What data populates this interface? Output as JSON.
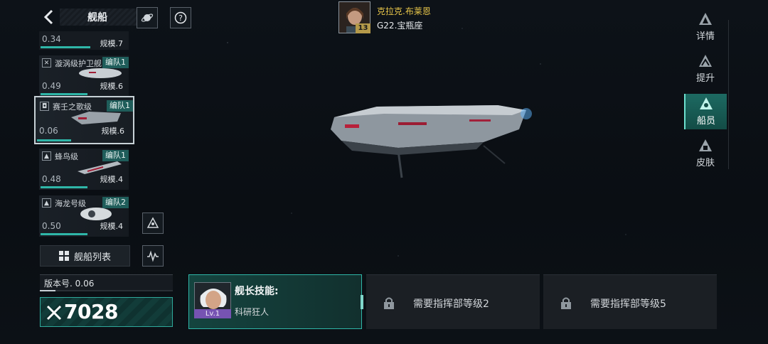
{
  "header": {
    "title": "舰船"
  },
  "commander": {
    "name": "克拉克.布莱恩",
    "level": "13",
    "system": "G22.宝瓶座"
  },
  "ship_list": {
    "top_partial": {
      "value": "0.34",
      "scale": "规模.7"
    },
    "items": [
      {
        "name": "漩涡级护卫舰",
        "fleet": "编队1",
        "value": "0.49",
        "scale": "规模.6",
        "progress": 0.55
      },
      {
        "name": "赛壬之歌级",
        "fleet": "编队1",
        "value": "0.06",
        "scale": "规模.6",
        "progress": 0.4,
        "selected": true
      },
      {
        "name": "蜂鸟级",
        "fleet": "编队1",
        "value": "0.48",
        "scale": "规模.4",
        "progress": 0.55
      },
      {
        "name": "海龙号级",
        "fleet": "编队2",
        "value": "0.50",
        "scale": "规模.4",
        "progress": 0.55
      }
    ],
    "list_button": "舰船列表"
  },
  "version": {
    "label": "版本号. 0.06",
    "progress": 0.12
  },
  "power": {
    "value": "7028"
  },
  "skills": {
    "captain": {
      "label": "舰长技能:",
      "name": "科研狂人",
      "level": "Lv.1"
    },
    "locked1": "需要指挥部等级2",
    "locked2": "需要指挥部等级5"
  },
  "right_nav": [
    {
      "label": "详情"
    },
    {
      "label": "提升"
    },
    {
      "label": "船员",
      "active": true
    },
    {
      "label": "皮肤"
    }
  ],
  "colors": {
    "accent": "#2fb6a8",
    "fleet_badge": "#1f5d5a",
    "commander_name": "#e8c64a",
    "level_badge": "#7653b2"
  }
}
